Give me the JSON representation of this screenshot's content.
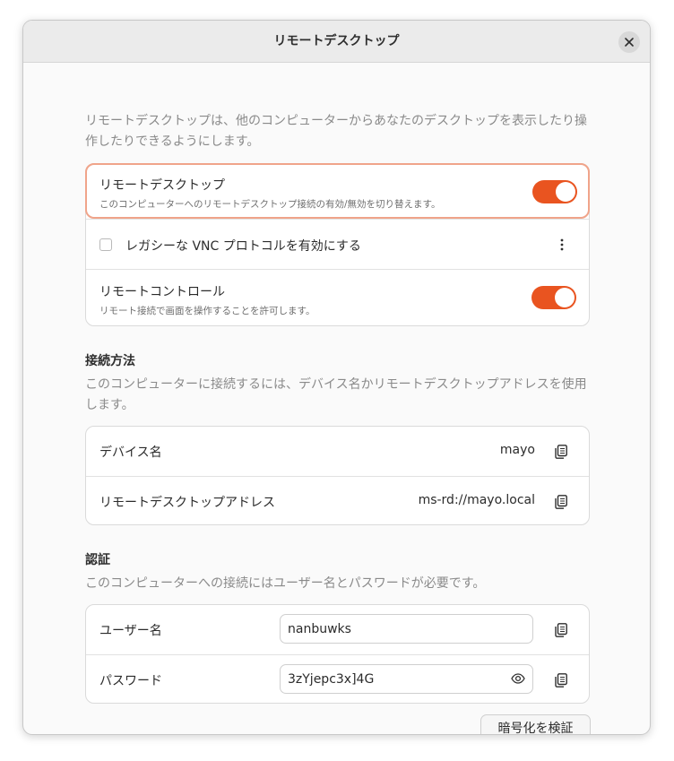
{
  "window": {
    "title": "リモートデスクトップ"
  },
  "intro": "リモートデスクトップは、他のコンピューターからあなたのデスクトップを表示したり操作したりできるようにします。",
  "rows": {
    "remote_desktop": {
      "title": "リモートデスクトップ",
      "subtitle": "このコンピューターへのリモートデスクトップ接続の有効/無効を切り替えます。",
      "enabled": true
    },
    "legacy_vnc": {
      "label": "レガシーな VNC プロトコルを有効にする",
      "checked": false
    },
    "remote_control": {
      "title": "リモートコントロール",
      "subtitle": "リモート接続で画面を操作することを許可します。",
      "enabled": true
    }
  },
  "connect": {
    "heading": "接続方法",
    "description": "このコンピューターに接続するには、デバイス名かリモートデスクトップアドレスを使用します。",
    "device_label": "デバイス名",
    "device_value": "mayo",
    "address_label": "リモートデスクトップアドレス",
    "address_value": "ms-rd://mayo.local"
  },
  "auth": {
    "heading": "認証",
    "description": "このコンピューターへの接続にはユーザー名とパスワードが必要です。",
    "username_label": "ユーザー名",
    "username_value": "nanbuwks",
    "password_label": "パスワード",
    "password_value": "3zYjepc3x]4G",
    "verify_button": "暗号化を検証"
  },
  "colors": {
    "accent": "#e95420",
    "focus_border": "#f0a48a"
  }
}
